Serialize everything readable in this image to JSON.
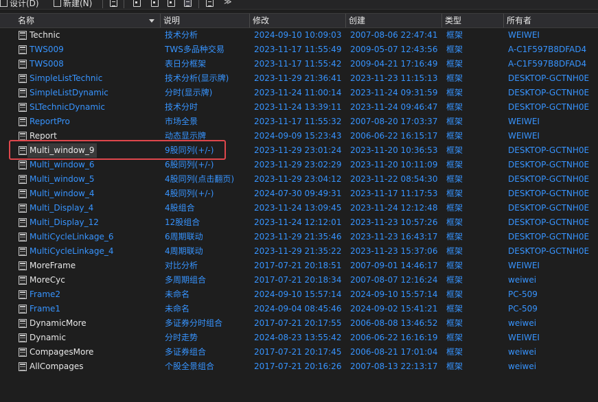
{
  "toolbar": {
    "design_label": "设计(D)",
    "new_label": "新建(N)",
    "icons": [
      "list-view-icon",
      "single-view-icon",
      "detail-view-icon",
      "report-view-icon",
      "layers-icon",
      "expand-icon"
    ]
  },
  "columns": [
    "名称",
    "说明",
    "修改",
    "创建",
    "类型",
    "所有者"
  ],
  "colors": {
    "background": "#1e1e1e",
    "link": "#3794ff",
    "highlight_border": "#e0474c"
  },
  "rows": [
    {
      "name": "Technic",
      "desc": "技术分析",
      "modified": "2024-09-10 10:09:03",
      "created": "2007-08-06 22:47:41",
      "type": "框架",
      "owner": "WEIWEI",
      "name_color": "white"
    },
    {
      "name": "TWS009",
      "desc": "TWS多品种交易",
      "modified": "2023-11-17 11:55:49",
      "created": "2009-05-07 12:43:56",
      "type": "框架",
      "owner": "A-C1F597B8DFAD4",
      "name_color": "blue"
    },
    {
      "name": "TWS008",
      "desc": "表日分框架",
      "modified": "2023-11-17 11:55:42",
      "created": "2009-04-21 17:16:49",
      "type": "框架",
      "owner": "A-C1F597B8DFAD4",
      "name_color": "blue"
    },
    {
      "name": "SimpleListTechnic",
      "desc": "技术分析(显示牌)",
      "modified": "2023-11-29 21:36:41",
      "created": "2023-11-23 11:15:13",
      "type": "框架",
      "owner": "DESKTOP-GCTNH0E",
      "name_color": "blue"
    },
    {
      "name": "SimpleListDynamic",
      "desc": "分时(显示牌)",
      "modified": "2023-11-24 11:00:14",
      "created": "2023-11-24 09:31:59",
      "type": "框架",
      "owner": "DESKTOP-GCTNH0E",
      "name_color": "blue"
    },
    {
      "name": "SLTechnicDynamic",
      "desc": "技术分时",
      "modified": "2023-11-24 13:39:11",
      "created": "2023-11-24 09:46:47",
      "type": "框架",
      "owner": "DESKTOP-GCTNH0E",
      "name_color": "blue"
    },
    {
      "name": "ReportPro",
      "desc": "市场全景",
      "modified": "2023-11-17 11:55:32",
      "created": "2007-08-20 17:03:37",
      "type": "框架",
      "owner": "WEIWEI",
      "name_color": "blue"
    },
    {
      "name": "Report",
      "desc": "动态显示牌",
      "modified": "2024-09-09 15:23:43",
      "created": "2006-06-22 16:15:17",
      "type": "框架",
      "owner": "WEIWEI",
      "name_color": "white"
    },
    {
      "name": "Multi_window_9",
      "desc": "9股同列(+/-)",
      "modified": "2023-11-29 23:01:24",
      "created": "2023-11-20 10:36:53",
      "type": "框架",
      "owner": "DESKTOP-GCTNH0E",
      "name_color": "white",
      "selected": true
    },
    {
      "name": "Multi_window_6",
      "desc": "6股同列(+/-)",
      "modified": "2023-11-29 23:02:29",
      "created": "2023-11-20 10:11:09",
      "type": "框架",
      "owner": "DESKTOP-GCTNH0E",
      "name_color": "blue"
    },
    {
      "name": "Multi_window_5",
      "desc": "4股同列(点击翻页)",
      "modified": "2023-11-29 23:04:12",
      "created": "2023-11-22 08:54:30",
      "type": "框架",
      "owner": "DESKTOP-GCTNH0E",
      "name_color": "blue"
    },
    {
      "name": "Multi_window_4",
      "desc": "4股同列(+/-)",
      "modified": "2024-07-30 09:49:31",
      "created": "2023-11-17 11:17:53",
      "type": "框架",
      "owner": "DESKTOP-GCTNH0E",
      "name_color": "blue"
    },
    {
      "name": "Multi_Display_4",
      "desc": "4股组合",
      "modified": "2023-11-24 13:09:45",
      "created": "2023-11-24 12:12:48",
      "type": "框架",
      "owner": "DESKTOP-GCTNH0E",
      "name_color": "blue"
    },
    {
      "name": "Multi_Display_12",
      "desc": "12股组合",
      "modified": "2023-11-24 12:12:01",
      "created": "2023-11-23 10:57:26",
      "type": "框架",
      "owner": "DESKTOP-GCTNH0E",
      "name_color": "blue"
    },
    {
      "name": "MultiCycleLinkage_6",
      "desc": "6周期联动",
      "modified": "2023-11-29 21:35:46",
      "created": "2023-11-23 16:43:17",
      "type": "框架",
      "owner": "DESKTOP-GCTNH0E",
      "name_color": "blue"
    },
    {
      "name": "MultiCycleLinkage_4",
      "desc": "4周期联动",
      "modified": "2023-11-29 21:35:22",
      "created": "2023-11-23 15:37:06",
      "type": "框架",
      "owner": "DESKTOP-GCTNH0E",
      "name_color": "blue"
    },
    {
      "name": "MoreFrame",
      "desc": "对比分析",
      "modified": "2017-07-21 20:18:51",
      "created": "2007-09-01 14:46:17",
      "type": "框架",
      "owner": "WEIWEI",
      "name_color": "white"
    },
    {
      "name": "MoreCyc",
      "desc": "多周期组合",
      "modified": "2017-07-21 20:18:34",
      "created": "2007-08-07 12:16:24",
      "type": "框架",
      "owner": "weiwei",
      "name_color": "white"
    },
    {
      "name": "Frame2",
      "desc": "未命名",
      "modified": "2024-09-10 15:57:14",
      "created": "2024-09-10 15:57:14",
      "type": "框架",
      "owner": "PC-509",
      "name_color": "blue"
    },
    {
      "name": "Frame1",
      "desc": "未命名",
      "modified": "2024-09-04 08:45:46",
      "created": "2024-09-02 15:41:21",
      "type": "框架",
      "owner": "PC-509",
      "name_color": "blue"
    },
    {
      "name": "DynamicMore",
      "desc": "多证券分时组合",
      "modified": "2017-07-21 20:17:55",
      "created": "2006-08-08 13:46:52",
      "type": "框架",
      "owner": "weiwei",
      "name_color": "white"
    },
    {
      "name": "Dynamic",
      "desc": "分时走势",
      "modified": "2024-08-23 13:55:42",
      "created": "2006-06-22 16:16:19",
      "type": "框架",
      "owner": "WEIWEI",
      "name_color": "white"
    },
    {
      "name": "CompagesMore",
      "desc": "多证券组合",
      "modified": "2017-07-21 20:17:45",
      "created": "2006-08-21 17:01:04",
      "type": "框架",
      "owner": "weiwei",
      "name_color": "white"
    },
    {
      "name": "AllCompages",
      "desc": "个股全景组合",
      "modified": "2017-07-21 20:16:26",
      "created": "2007-08-13 22:13:17",
      "type": "框架",
      "owner": "weiwei",
      "name_color": "white"
    }
  ]
}
